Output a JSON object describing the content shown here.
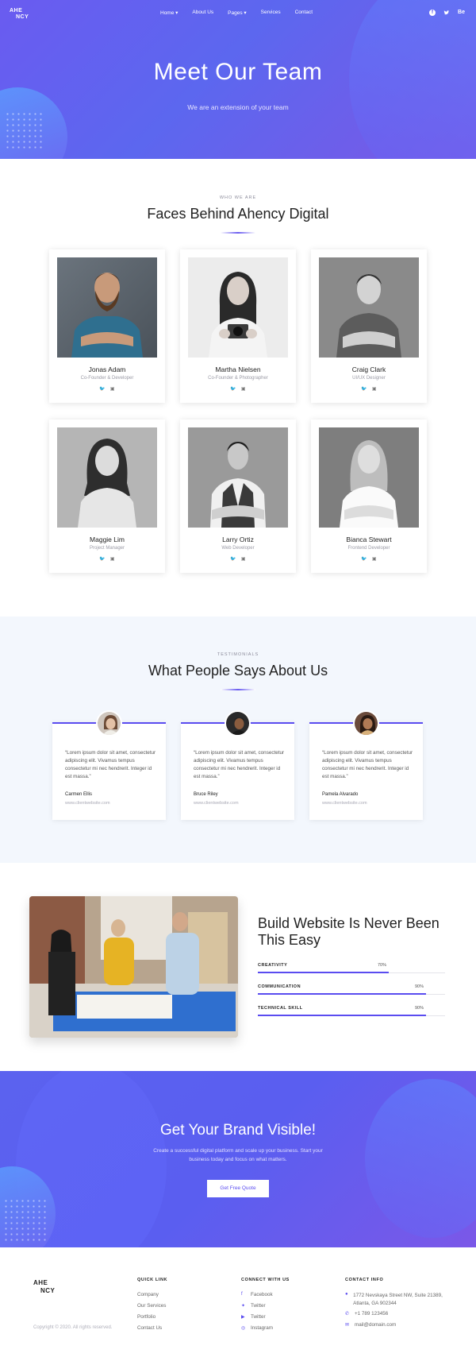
{
  "nav": {
    "logo_line1": "AHE",
    "logo_line2": "NCY",
    "menu": [
      "Home ▾",
      "About Us",
      "Pages ▾",
      "Services",
      "Contact"
    ],
    "social": [
      "f",
      "t",
      "Be"
    ]
  },
  "hero": {
    "title": "Meet Our Team",
    "subtitle": "We are an extension of your team"
  },
  "team_section": {
    "kicker": "WHO WE ARE",
    "title": "Faces Behind Ahency Digital",
    "members": [
      {
        "name": "Jonas Adam",
        "role": "Co-Founder & Developer"
      },
      {
        "name": "Martha Nielsen",
        "role": "Co-Founder & Photographer"
      },
      {
        "name": "Craig Clark",
        "role": "UI/UX Designer"
      },
      {
        "name": "Maggie Lim",
        "role": "Project Manager"
      },
      {
        "name": "Larry Ortiz",
        "role": "Web Developer"
      },
      {
        "name": "Bianca Stewart",
        "role": "Frontend Developer"
      }
    ]
  },
  "testimonials": {
    "kicker": "TESTIMONIALS",
    "title": "What People Says About Us",
    "items": [
      {
        "quote": "“Lorem ipsum dolor sit amet, consectetur adipiscing elit. Vivamus tempus consectetur mi nec hendrerit. Integer id est massa.”",
        "author": "Carmen Ellis",
        "site": "www.clientwebsite.com"
      },
      {
        "quote": "“Lorem ipsum dolor sit amet, consectetur adipiscing elit. Vivamus tempus consectetur mi nec hendrerit. Integer id est massa.”",
        "author": "Bruce Riley",
        "site": "www.clientwebsite.com"
      },
      {
        "quote": "“Lorem ipsum dolor sit amet, consectetur adipiscing elit. Vivamus tempus consectetur mi nec hendrerit. Integer id est massa.”",
        "author": "Pamela Alvarado",
        "site": "www.clientwebsite.com"
      }
    ]
  },
  "skills": {
    "title": "Build Website Is Never Been This Easy",
    "items": [
      {
        "label": "CREATIVITY",
        "percent_text": "70%",
        "value": 0.7
      },
      {
        "label": "COMMUNICATION",
        "percent_text": "90%",
        "value": 0.9
      },
      {
        "label": "TECHNICAL SKILL",
        "percent_text": "90%",
        "value": 0.9
      }
    ]
  },
  "cta": {
    "title": "Get Your Brand Visible!",
    "description": "Create a successful digital platform and scale up your business. Start your business today and focus on what matters.",
    "button": "Get Free Quote"
  },
  "footer": {
    "logo_line1": "AHE",
    "logo_line2": "NCY",
    "copyright": "Copyright © 2020. All rights reserved.",
    "quick_link": {
      "heading": "QUICK LINK",
      "items": [
        "Company",
        "Our Services",
        "Portfolio",
        "Contact Us"
      ]
    },
    "connect": {
      "heading": "CONNECT WITH US",
      "items": [
        "Facebook",
        "Twitter",
        "Twitter",
        "Instagram"
      ]
    },
    "contact": {
      "heading": "CONTACT INFO",
      "address": "1772 Nevskaya Street NW, Suite 21389, Atlanta, GA 902344",
      "phone": "+1 789 123456",
      "email": "mail@domain.com"
    }
  },
  "colors": {
    "accent": "#5a4cf0",
    "hero_gradient_start": "#6a5bf0",
    "hero_gradient_end": "#7a58e6",
    "testimonial_bg": "#f3f7fd"
  }
}
